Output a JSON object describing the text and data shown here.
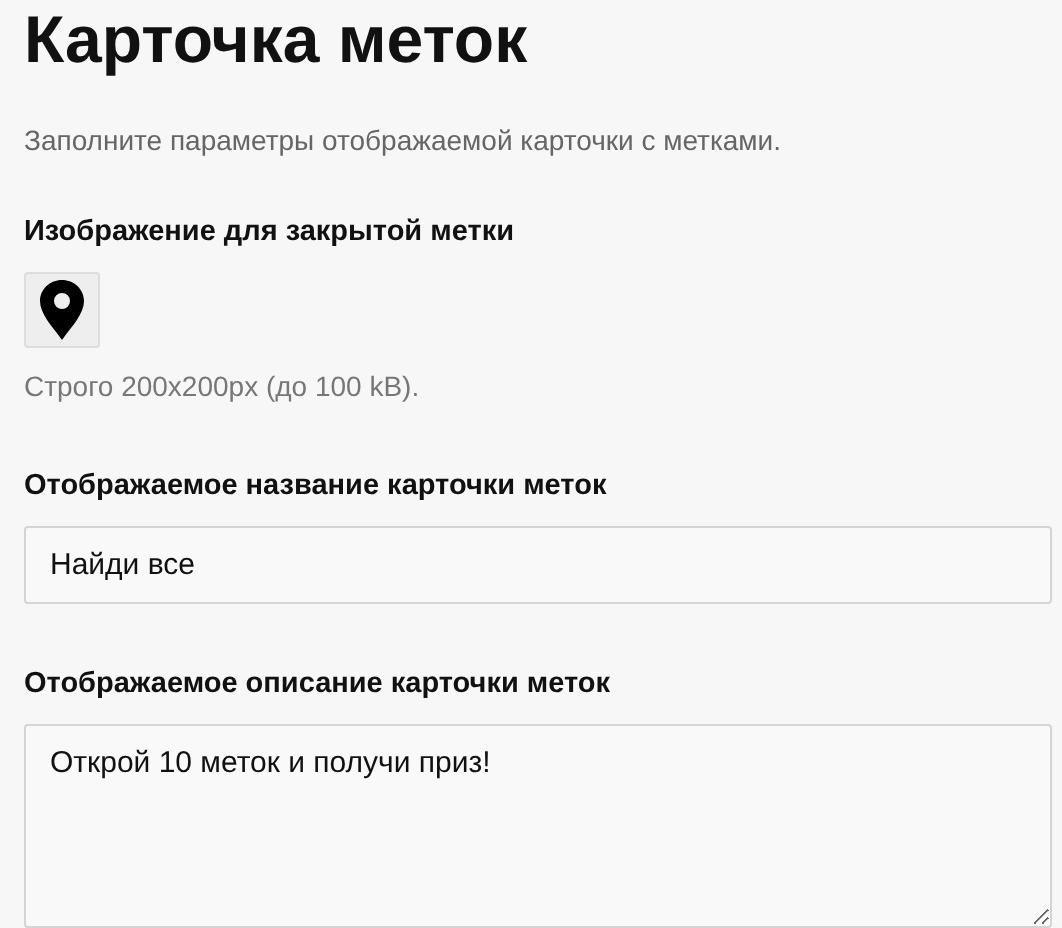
{
  "title": "Карточка меток",
  "subtitle": "Заполните параметры отображаемой карточки с метками.",
  "image_field": {
    "label": "Изображение для закрытой метки",
    "hint": "Строго 200x200px (до 100 kB)."
  },
  "fields": [
    {
      "kind": "input",
      "label": "Отображаемое название карточки меток",
      "value": "Найди все"
    },
    {
      "kind": "textarea",
      "label": "Отображаемое описание карточки меток",
      "value": "Открой 10 меток и получи приз!"
    }
  ]
}
